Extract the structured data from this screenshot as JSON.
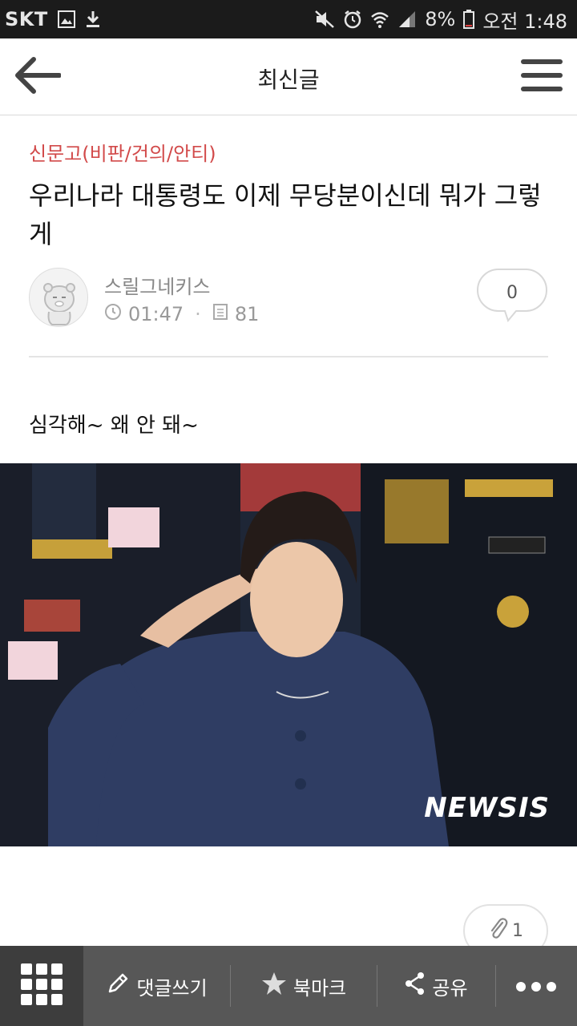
{
  "status_bar": {
    "carrier": "SKT",
    "battery": "8%",
    "time": "오전 1:48"
  },
  "header": {
    "title": "최신글"
  },
  "post": {
    "category": "신문고(비판/건의/안티)",
    "title": "우리나라 대통령도 이제 무당분이신데 뭐가 그렇게",
    "author": "스릴그네키스",
    "time": "01:47",
    "views": "81",
    "comment_count": "0",
    "body_text": "심각해~ 왜 안 돼~",
    "image_watermark": "NEWSIS",
    "attachment_count": "1"
  },
  "toolbar": {
    "comment_label": "댓글쓰기",
    "bookmark_label": "북마크",
    "share_label": "공유"
  },
  "colors": {
    "category": "#d24a4a",
    "toolbar_bg": "#575757",
    "toolbar_grid_bg": "#3d3d3d",
    "statusbar_bg": "#1b1b1b"
  }
}
